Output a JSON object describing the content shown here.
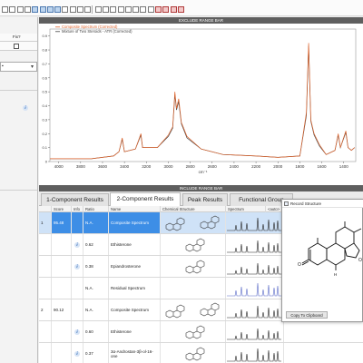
{
  "toolbar": {
    "button_count": 24
  },
  "left_panel": {
    "fix_header": "Fix?",
    "info_icon": "info-icon",
    "dropdown_caret": "chevron-down-icon"
  },
  "range_bars": {
    "top": "EXCLUDE RANGE BAR",
    "bottom": "INCLUDE RANGE BAR"
  },
  "chart_data": {
    "type": "line",
    "xlabel": "cm⁻¹",
    "x_ticks": [
      4000,
      3800,
      3600,
      3400,
      3200,
      3000,
      2800,
      2600,
      2400,
      2200,
      2000,
      1800,
      1600,
      1400
    ],
    "y_ticks": [
      0,
      0.1,
      0.2,
      0.3,
      0.4,
      0.5,
      0.6,
      0.7,
      0.8,
      0.9
    ],
    "ylim": [
      0,
      0.95
    ],
    "xlim": [
      4080,
      1290
    ],
    "x_reversed": true,
    "series": [
      {
        "name": "Composite Spectrum (Corrected)",
        "color": "#e0662f",
        "points": [
          [
            4080,
            0.02
          ],
          [
            3700,
            0.02
          ],
          [
            3500,
            0.04
          ],
          [
            3450,
            0.07
          ],
          [
            3420,
            0.17
          ],
          [
            3400,
            0.07
          ],
          [
            3300,
            0.09
          ],
          [
            3250,
            0.2
          ],
          [
            3235,
            0.1
          ],
          [
            3100,
            0.1
          ],
          [
            3000,
            0.19
          ],
          [
            2960,
            0.25
          ],
          [
            2940,
            0.5
          ],
          [
            2925,
            0.38
          ],
          [
            2905,
            0.45
          ],
          [
            2880,
            0.28
          ],
          [
            2860,
            0.24
          ],
          [
            2830,
            0.18
          ],
          [
            2700,
            0.09
          ],
          [
            2500,
            0.05
          ],
          [
            2200,
            0.04
          ],
          [
            2000,
            0.03
          ],
          [
            1800,
            0.04
          ],
          [
            1740,
            0.35
          ],
          [
            1720,
            0.85
          ],
          [
            1700,
            0.3
          ],
          [
            1670,
            0.2
          ],
          [
            1620,
            0.12
          ],
          [
            1560,
            0.05
          ],
          [
            1480,
            0.08
          ],
          [
            1450,
            0.2
          ],
          [
            1430,
            0.1
          ],
          [
            1380,
            0.22
          ],
          [
            1360,
            0.1
          ],
          [
            1330,
            0.08
          ],
          [
            1300,
            0.1
          ]
        ]
      },
      {
        "name": "Mixture of Two Steroids - ATR (Corrected)",
        "color": "#444444",
        "points": [
          [
            4080,
            0.02
          ],
          [
            3700,
            0.02
          ],
          [
            3500,
            0.04
          ],
          [
            3450,
            0.07
          ],
          [
            3420,
            0.16
          ],
          [
            3400,
            0.07
          ],
          [
            3300,
            0.09
          ],
          [
            3250,
            0.19
          ],
          [
            3235,
            0.1
          ],
          [
            3100,
            0.1
          ],
          [
            3000,
            0.18
          ],
          [
            2960,
            0.24
          ],
          [
            2940,
            0.48
          ],
          [
            2925,
            0.37
          ],
          [
            2905,
            0.43
          ],
          [
            2880,
            0.27
          ],
          [
            2860,
            0.23
          ],
          [
            2830,
            0.17
          ],
          [
            2700,
            0.09
          ],
          [
            2500,
            0.05
          ],
          [
            2200,
            0.04
          ],
          [
            2000,
            0.03
          ],
          [
            1800,
            0.04
          ],
          [
            1740,
            0.33
          ],
          [
            1720,
            0.83
          ],
          [
            1700,
            0.29
          ],
          [
            1670,
            0.19
          ],
          [
            1620,
            0.11
          ],
          [
            1560,
            0.05
          ],
          [
            1480,
            0.08
          ],
          [
            1450,
            0.19
          ],
          [
            1430,
            0.1
          ],
          [
            1380,
            0.21
          ],
          [
            1360,
            0.1
          ],
          [
            1330,
            0.08
          ],
          [
            1300,
            0.1
          ]
        ]
      }
    ]
  },
  "tabs": [
    {
      "label": "1-Component Results",
      "active": false
    },
    {
      "label": "2-Component Results",
      "active": true
    },
    {
      "label": "Peak Results",
      "active": false
    },
    {
      "label": "Functional Group",
      "active": false
    }
  ],
  "grid_headers": {
    "score": "Score",
    "info": "Info",
    "ratio": "Ratio",
    "name": "Name",
    "structure": "Chemical Structure",
    "spectrum": "Spectrum",
    "auto": "<auto>"
  },
  "rows": [
    {
      "num": "1",
      "score": "95.48",
      "info": false,
      "ratio": "N.A.",
      "name": "Composite Spectrum",
      "selected": true,
      "structure": "multi"
    },
    {
      "num": "",
      "score": "",
      "info": true,
      "ratio": "0.62",
      "name": "Ethisterone",
      "selected": false,
      "structure": "single"
    },
    {
      "num": "",
      "score": "",
      "info": true,
      "ratio": "0.38",
      "name": "Epiandrosterone",
      "selected": false,
      "structure": "single"
    },
    {
      "num": "",
      "score": "",
      "info": false,
      "ratio": "N.A.",
      "name": "Residual Spectrum",
      "selected": false,
      "structure": "none"
    },
    {
      "num": "2",
      "score": "90.12",
      "info": false,
      "ratio": "N.A.",
      "name": "Composite Spectrum",
      "selected": false,
      "structure": "multi"
    },
    {
      "num": "",
      "score": "",
      "info": true,
      "ratio": "0.60",
      "name": "Ethisterone",
      "selected": false,
      "structure": "single"
    },
    {
      "num": "",
      "score": "",
      "info": true,
      "ratio": "0.37",
      "name": "3α-Androstan-3β-ol-16-one",
      "selected": false,
      "structure": "single"
    }
  ],
  "popup": {
    "title": "Record Structure",
    "button": "Copy To Clipboard",
    "atom_o1": "O",
    "atom_o2": "O",
    "atom_h": "H"
  }
}
